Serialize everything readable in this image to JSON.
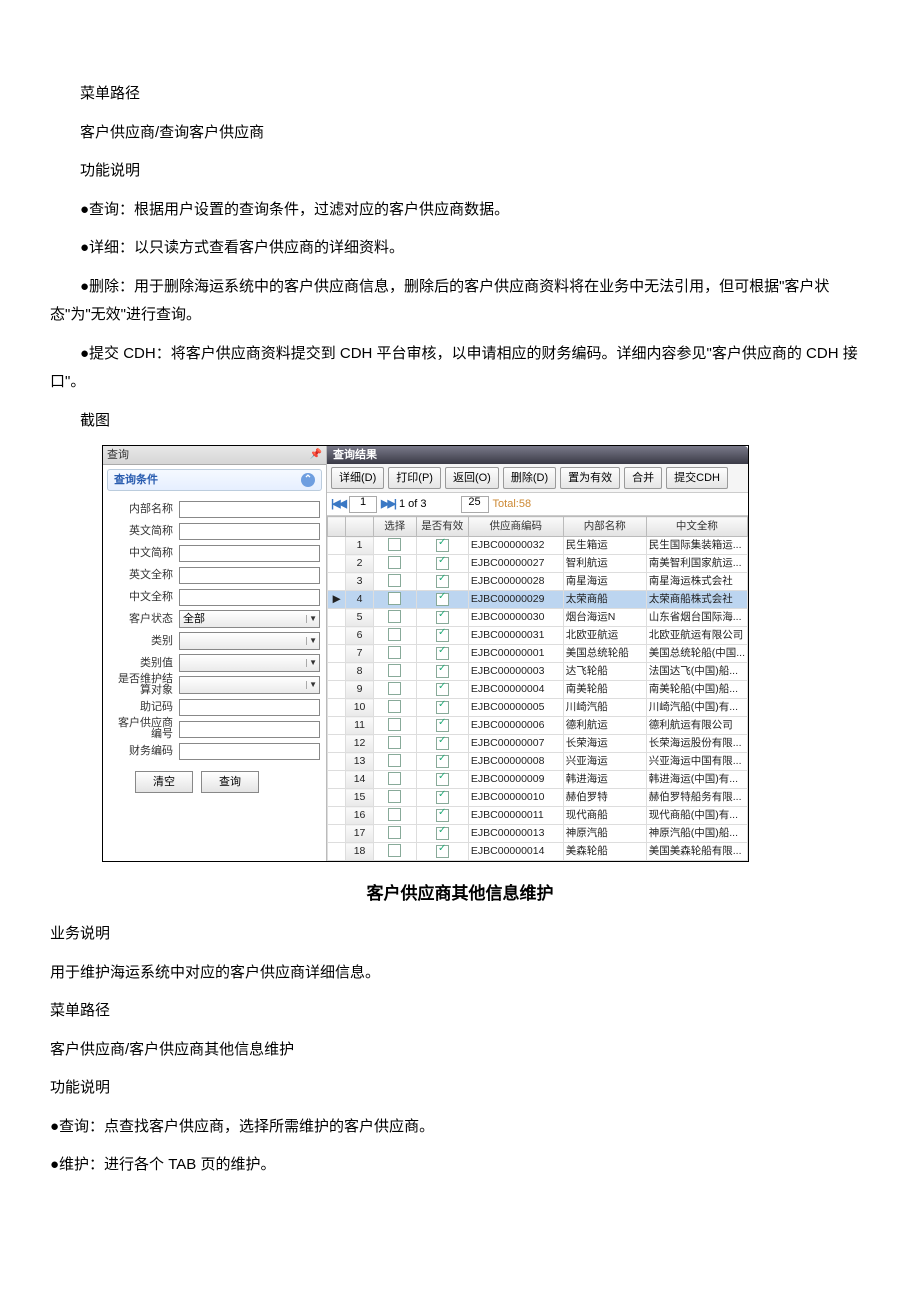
{
  "text": {
    "menu_path_label": "菜单路径",
    "menu_path_value": " 客户供应商/查询客户供应商",
    "func_label": "功能说明",
    "bullet_query": "●查询：根据用户设置的查询条件，过滤对应的客户供应商数据。",
    "bullet_detail": "●详细：以只读方式查看客户供应商的详细资料。",
    "bullet_delete": "●删除：用于删除海运系统中的客户供应商信息，删除后的客户供应商资料将在业务中无法引用，但可根据\"客户状态\"为\"无效\"进行查询。",
    "bullet_cdh": "●提交 CDH：将客户供应商资料提交到 CDH 平台审核，以申请相应的财务编码。详细内容参见\"客户供应商的 CDH 接口\"。",
    "screenshot_label": "截图",
    "subtitle": "客户供应商其他信息维护",
    "biz_label": "业务说明",
    "biz_text": " 用于维护海运系统中对应的客户供应商详细信息。",
    "menu_path_label2": "菜单路径",
    "menu_path_value2": " 客户供应商/客户供应商其他信息维护",
    "func_label2": "功能说明",
    "bullet_query2": "●查询：点查找客户供应商，选择所需维护的客户供应商。",
    "bullet_maintain": "●维护：进行各个 TAB 页的维护。"
  },
  "ui": {
    "left_title": "查询",
    "section_title": "查询条件",
    "form_labels": {
      "inner_name": "内部名称",
      "en_abbr": "英文简称",
      "cn_abbr": "中文简称",
      "en_full": "英文全称",
      "cn_full": "中文全称",
      "cust_status": "客户状态",
      "category": "类别",
      "cat_value": "类别值",
      "maintain_settle": "是否维护结算对象",
      "mnemonic": "助记码",
      "supplier_code": "客户供应商编号",
      "finance_code": "财务编码"
    },
    "status_all": "全部",
    "btn_clear": "清空",
    "btn_search": "查询",
    "right_title": "查询结果",
    "toolbar": {
      "detail": "详细(D)",
      "print": "打印(P)",
      "back": "返回(O)",
      "delete": "删除(D)",
      "set_valid": "置为有效",
      "merge": "合并",
      "submit_cdh": "提交CDH"
    },
    "pager": {
      "page": "1",
      "of": "1 of 3",
      "size": "25",
      "total": "Total:58"
    },
    "columns": [
      "选择",
      "是否有效",
      "供应商编码",
      "内部名称",
      "中文全称"
    ],
    "rows": [
      {
        "n": "1",
        "chk": false,
        "valid": true,
        "code": "EJBC00000032",
        "inner": "民生箱运",
        "full": "民生国际集装箱运..."
      },
      {
        "n": "2",
        "chk": false,
        "valid": true,
        "code": "EJBC00000027",
        "inner": "智利航运",
        "full": "南美智利国家航运..."
      },
      {
        "n": "3",
        "chk": false,
        "valid": true,
        "code": "EJBC00000028",
        "inner": "南星海运",
        "full": "南星海运株式会社"
      },
      {
        "n": "4",
        "chk": false,
        "valid": true,
        "code": "EJBC00000029",
        "inner": "太荣商船",
        "full": "太荣商船株式会社",
        "sel": true
      },
      {
        "n": "5",
        "chk": false,
        "valid": true,
        "code": "EJBC00000030",
        "inner": "烟台海运N",
        "full": "山东省烟台国际海..."
      },
      {
        "n": "6",
        "chk": false,
        "valid": true,
        "code": "EJBC00000031",
        "inner": "北欧亚航运",
        "full": "北欧亚航运有限公司"
      },
      {
        "n": "7",
        "chk": false,
        "valid": true,
        "code": "EJBC00000001",
        "inner": "美国总统轮船",
        "full": "美国总统轮船(中国..."
      },
      {
        "n": "8",
        "chk": false,
        "valid": true,
        "code": "EJBC00000003",
        "inner": "达飞轮船",
        "full": "法国达飞(中国)船..."
      },
      {
        "n": "9",
        "chk": false,
        "valid": true,
        "code": "EJBC00000004",
        "inner": "南美轮船",
        "full": "南美轮船(中国)船..."
      },
      {
        "n": "10",
        "chk": false,
        "valid": true,
        "code": "EJBC00000005",
        "inner": "川崎汽船",
        "full": "川崎汽船(中国)有..."
      },
      {
        "n": "11",
        "chk": false,
        "valid": true,
        "code": "EJBC00000006",
        "inner": "德利航运",
        "full": "德利航运有限公司"
      },
      {
        "n": "12",
        "chk": false,
        "valid": true,
        "code": "EJBC00000007",
        "inner": "长荣海运",
        "full": "长荣海运股份有限..."
      },
      {
        "n": "13",
        "chk": false,
        "valid": true,
        "code": "EJBC00000008",
        "inner": "兴亚海运",
        "full": "兴亚海运中国有限..."
      },
      {
        "n": "14",
        "chk": false,
        "valid": true,
        "code": "EJBC00000009",
        "inner": "韩进海运",
        "full": "韩进海运(中国)有..."
      },
      {
        "n": "15",
        "chk": false,
        "valid": true,
        "code": "EJBC00000010",
        "inner": "赫伯罗特",
        "full": "赫伯罗特船务有限..."
      },
      {
        "n": "16",
        "chk": false,
        "valid": true,
        "code": "EJBC00000011",
        "inner": "现代商船",
        "full": "现代商船(中国)有..."
      },
      {
        "n": "17",
        "chk": false,
        "valid": true,
        "code": "EJBC00000013",
        "inner": "神原汽船",
        "full": "神原汽船(中国)船..."
      },
      {
        "n": "18",
        "chk": false,
        "valid": true,
        "code": "EJBC00000014",
        "inner": "美森轮船",
        "full": "美国美森轮船有限..."
      }
    ]
  }
}
